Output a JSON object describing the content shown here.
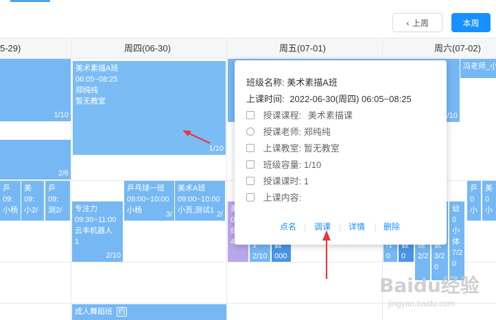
{
  "toolbar": {
    "prev_label": "上周",
    "current_label": "本周"
  },
  "week_columns": [
    "5-29)",
    "周四(06-30)",
    "周五(07-01)",
    "周六(07-02)"
  ],
  "cards": {
    "c1": {
      "count": "1/10"
    },
    "c2": {
      "count": "2/6"
    },
    "c3": {
      "lines": [
        "美术素描A班",
        "06:05~08:25",
        "郑纯纯",
        "暂无教室"
      ],
      "count": "1/10"
    },
    "c4": {
      "lines": [
        "乒",
        "09:",
        "小杨"
      ]
    },
    "c5": {
      "lines": [
        "美",
        "09:",
        "小2/"
      ]
    },
    "c6": {
      "lines": [
        "乒",
        "09:",
        "测2/"
      ]
    },
    "c7": {
      "lines": [
        "专注力",
        "09:30~11:00",
        "云丰机器人",
        "1"
      ],
      "count": "2/10"
    },
    "c8": {
      "lines": [
        "乒乓球一班",
        "09:00~10:00",
        "小杨"
      ],
      "count": "3/"
    },
    "c9": {
      "lines": [
        "美术A班",
        "09:00~10:00",
        "小贡,测试1"
      ],
      "count": "2/"
    },
    "c10": {
      "lines": [
        "美",
        "0",
        "综",
        "4/30"
      ]
    },
    "c11": {
      "lines": [
        "1",
        "2/10"
      ]
    },
    "c12": {
      "lines": [
        "数",
        "000"
      ]
    },
    "c13": {
      "count": "/10"
    },
    "c14": {
      "lines": [
        "冯老师_小"
      ]
    },
    "c15": {
      "lines": [
        "乒",
        "0",
        "小"
      ]
    },
    "c16": {
      "lines": [
        "美",
        "0",
        "小"
      ]
    },
    "c17": {
      "lines": [
        "/1",
        "0"
      ]
    },
    "c18": {
      "lines": [
        "数",
        "0"
      ]
    },
    "c19": {
      "lines": [
        "综",
        "2/2"
      ]
    },
    "c20": {
      "lines": [
        "数",
        "3/2",
        "0"
      ]
    },
    "c21": {
      "lines": [
        "幼",
        "0",
        "小",
        "体",
        "7/2",
        "0"
      ]
    },
    "c22": {
      "lines": [
        "成人舞蹈班",
        "约"
      ]
    }
  },
  "popup": {
    "class_name_label": "班级名称:",
    "class_name": "美术素描A班",
    "time_label": "上课时间:",
    "time": "2022-06-30(周四) 06:05~08:25",
    "course_label": "授课课程:",
    "course": "美术素描课",
    "teacher_label": "授课老师:",
    "teacher": "郑纯纯",
    "room_label": "上课教室:",
    "room": "暂无教室",
    "capacity_label": "班级容量:",
    "capacity": "1/10",
    "hours_label": "授课课时:",
    "hours": "1",
    "content_label": "上课内容:",
    "content": "",
    "actions": {
      "rollcall": "点名",
      "adjust": "调课",
      "detail": "详情",
      "delete": "删除"
    }
  },
  "watermark": {
    "logo": "Baidu经验",
    "url": "jingyan.baidu.com"
  },
  "colors": {
    "card": "#75b8f4",
    "accent": "#1890ff",
    "arrow": "#e8383d",
    "purple": "#b9a6ea"
  }
}
